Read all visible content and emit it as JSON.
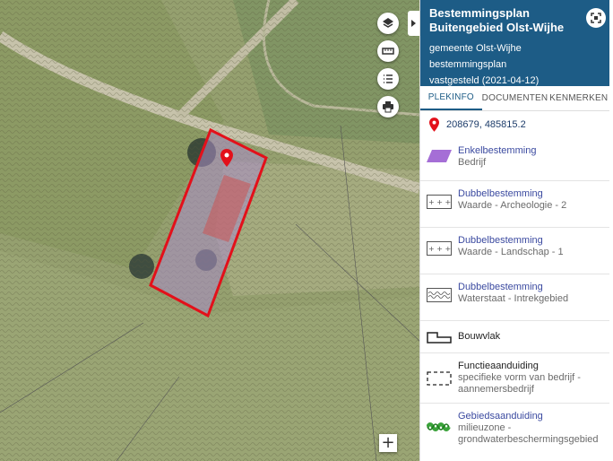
{
  "map": {
    "buttons": [
      {
        "name": "layers",
        "icon": "layers-icon"
      },
      {
        "name": "measure",
        "icon": "ruler-icon"
      },
      {
        "name": "legend",
        "icon": "list-icon"
      },
      {
        "name": "print",
        "icon": "printer-icon"
      }
    ],
    "zoom_in_label": "+"
  },
  "panel": {
    "title": "Bestemmingsplan Buitengebied Olst-Wijhe",
    "municipality": "gemeente Olst-Wijhe",
    "type": "bestemmingsplan",
    "status": "vastgesteld (2021-04-12)",
    "header_color": "#1d5c86",
    "tabs": [
      "PLEKINFO",
      "DOCUMENTEN",
      "KENMERKEN"
    ],
    "active_tab": "PLEKINFO",
    "coordinates": "208679, 485815.2",
    "legend": [
      {
        "title": "Enkelbestemming",
        "sub": "Bedrijf",
        "symbol": "purple-parallelogram"
      },
      {
        "title": "Dubbelbestemming",
        "sub": "Waarde - Archeologie - 2",
        "symbol": "plus-grid"
      },
      {
        "title": "Dubbelbestemming",
        "sub": "Waarde - Landschap - 1",
        "symbol": "plus-grid"
      },
      {
        "title": "Dubbelbestemming",
        "sub": "Waterstaat - Intrekgebied",
        "symbol": "wave-pattern"
      },
      {
        "title": "Bouwvlak",
        "sub": "",
        "symbol": "bouwvlak-outline"
      },
      {
        "title": "Functieaanduiding",
        "sub": "specifieke vorm van bedrijf - aannemersbedrijf",
        "symbol": "dashed-box"
      },
      {
        "title": "Gebiedsaanduiding",
        "sub": "milieuzone - grondwaterbeschermingsgebied",
        "symbol": "green-chain"
      }
    ]
  }
}
